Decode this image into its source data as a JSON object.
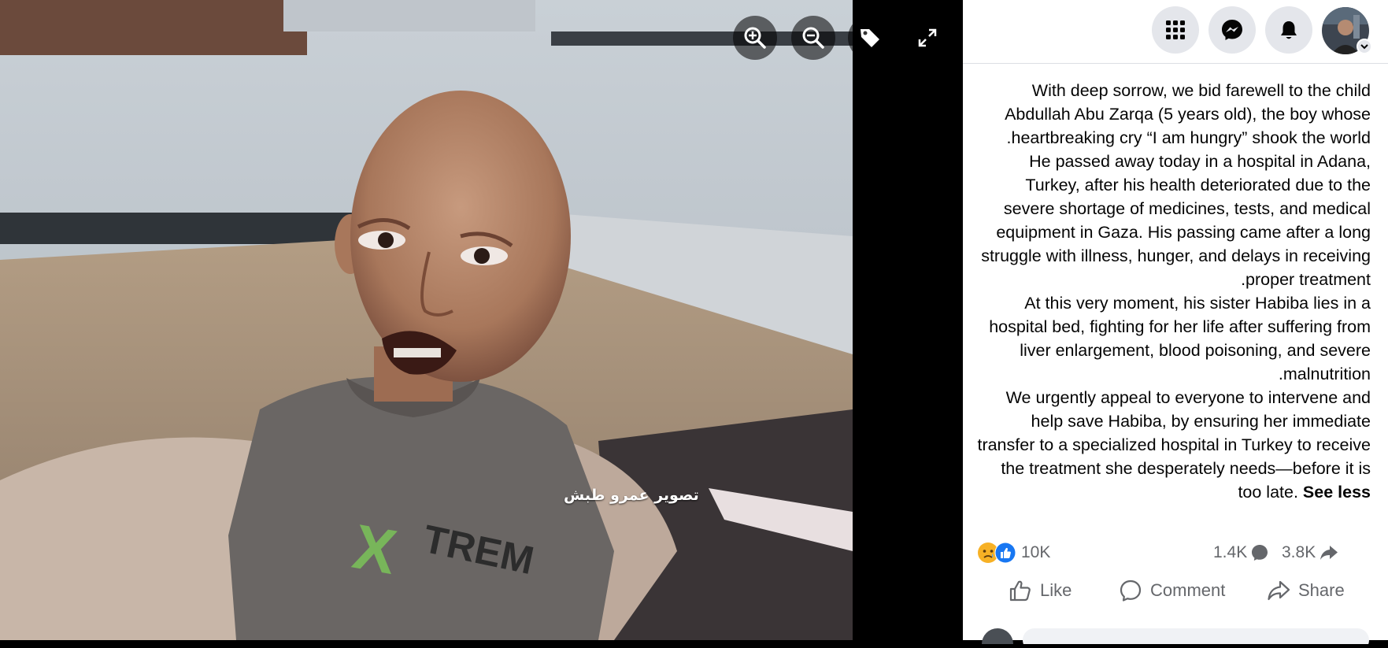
{
  "viewer": {
    "watermark": "تصوير عمرو طبش",
    "icons": [
      "zoom-in-icon",
      "zoom-out-icon",
      "tag-icon",
      "fullscreen-icon"
    ]
  },
  "topbar": {
    "icons": [
      "menu-grid-icon",
      "messenger-icon",
      "bell-icon",
      "chevron-down-icon"
    ]
  },
  "post": {
    "text": "With deep sorrow, we bid farewell to the child Abdullah Abu Zarqa (5 years old), the boy whose heartbreaking cry “I am hungry” shook the world.\nHe passed away today in a hospital in Adana, Turkey, after his health deteriorated due to the severe shortage of medicines, tests, and medical equipment in Gaza. His passing came after a long struggle with illness, hunger, and delays in receiving proper treatment.\nAt this very moment, his sister Habiba lies in a hospital bed, fighting for her life after suffering from liver enlargement, blood poisoning, and severe malnutrition.\nWe urgently appeal to everyone to intervene and help save Habiba, by ensuring her immediate transfer to a specialized hospital in Turkey to receive the treatment she desperately needs—before it is too late. ",
    "see_less": "See less"
  },
  "stats": {
    "reactions": "10K",
    "comments": "1.4K",
    "shares": "3.8K"
  },
  "actions": {
    "like": "Like",
    "comment": "Comment",
    "share": "Share"
  },
  "colors": {
    "like_blue": "#1877f2",
    "sad_yellow": "#f7b125",
    "muted_text": "#65676b",
    "button_gray": "#e4e6eb"
  }
}
